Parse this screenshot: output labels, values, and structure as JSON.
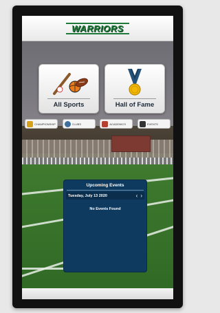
{
  "header": {
    "logo_text": "WARRIORS"
  },
  "tiles": [
    {
      "label": "All Sports",
      "icon": "sports-equipment-icon"
    },
    {
      "label": "Hall of Fame",
      "icon": "medal-icon"
    }
  ],
  "categories": [
    {
      "label": "CHAMPIONSHIP",
      "icon": "trophy-icon",
      "color": "#d6a21b"
    },
    {
      "label": "CLUBS",
      "icon": "person-icon",
      "color": "#3d6f9a"
    },
    {
      "label": "ACADEMICS",
      "icon": "books-icon",
      "color": "#b5402f"
    },
    {
      "label": "EVENTS",
      "icon": "calendar-icon",
      "color": "#333333"
    }
  ],
  "events": {
    "title": "Upcoming Events",
    "date": "Tuesday, July 13 2020",
    "prev": "‹",
    "next": "›",
    "empty_message": "No Events Found"
  },
  "colors": {
    "brand_green": "#1f7a3a",
    "events_panel": "#0e3a5f"
  }
}
